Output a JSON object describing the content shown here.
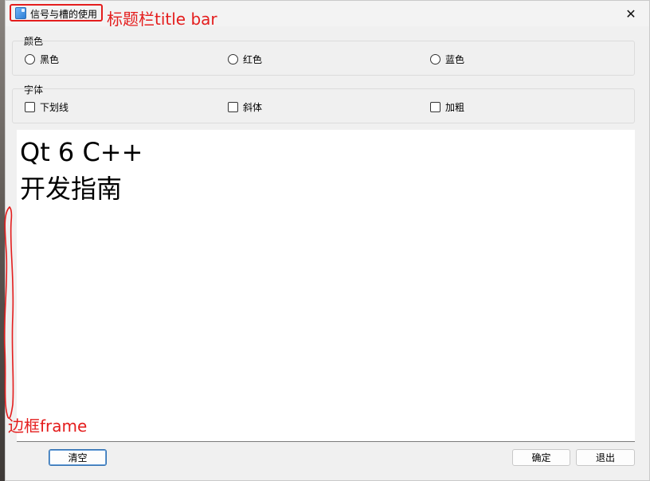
{
  "window": {
    "title": "信号与槽的使用",
    "close_glyph": "✕"
  },
  "color_group": {
    "title": "颜色",
    "options": [
      "黑色",
      "红色",
      "蓝色"
    ]
  },
  "font_group": {
    "title": "字体",
    "options": [
      "下划线",
      "斜体",
      "加粗"
    ]
  },
  "editor": {
    "lines": [
      "Qt 6 C++",
      "开发指南"
    ]
  },
  "buttons": {
    "clear": "清空",
    "ok": "确定",
    "exit": "退出"
  },
  "annotations": {
    "title_bar": "标题栏title bar",
    "frame": "边框frame",
    "color": "#e41d1d"
  }
}
